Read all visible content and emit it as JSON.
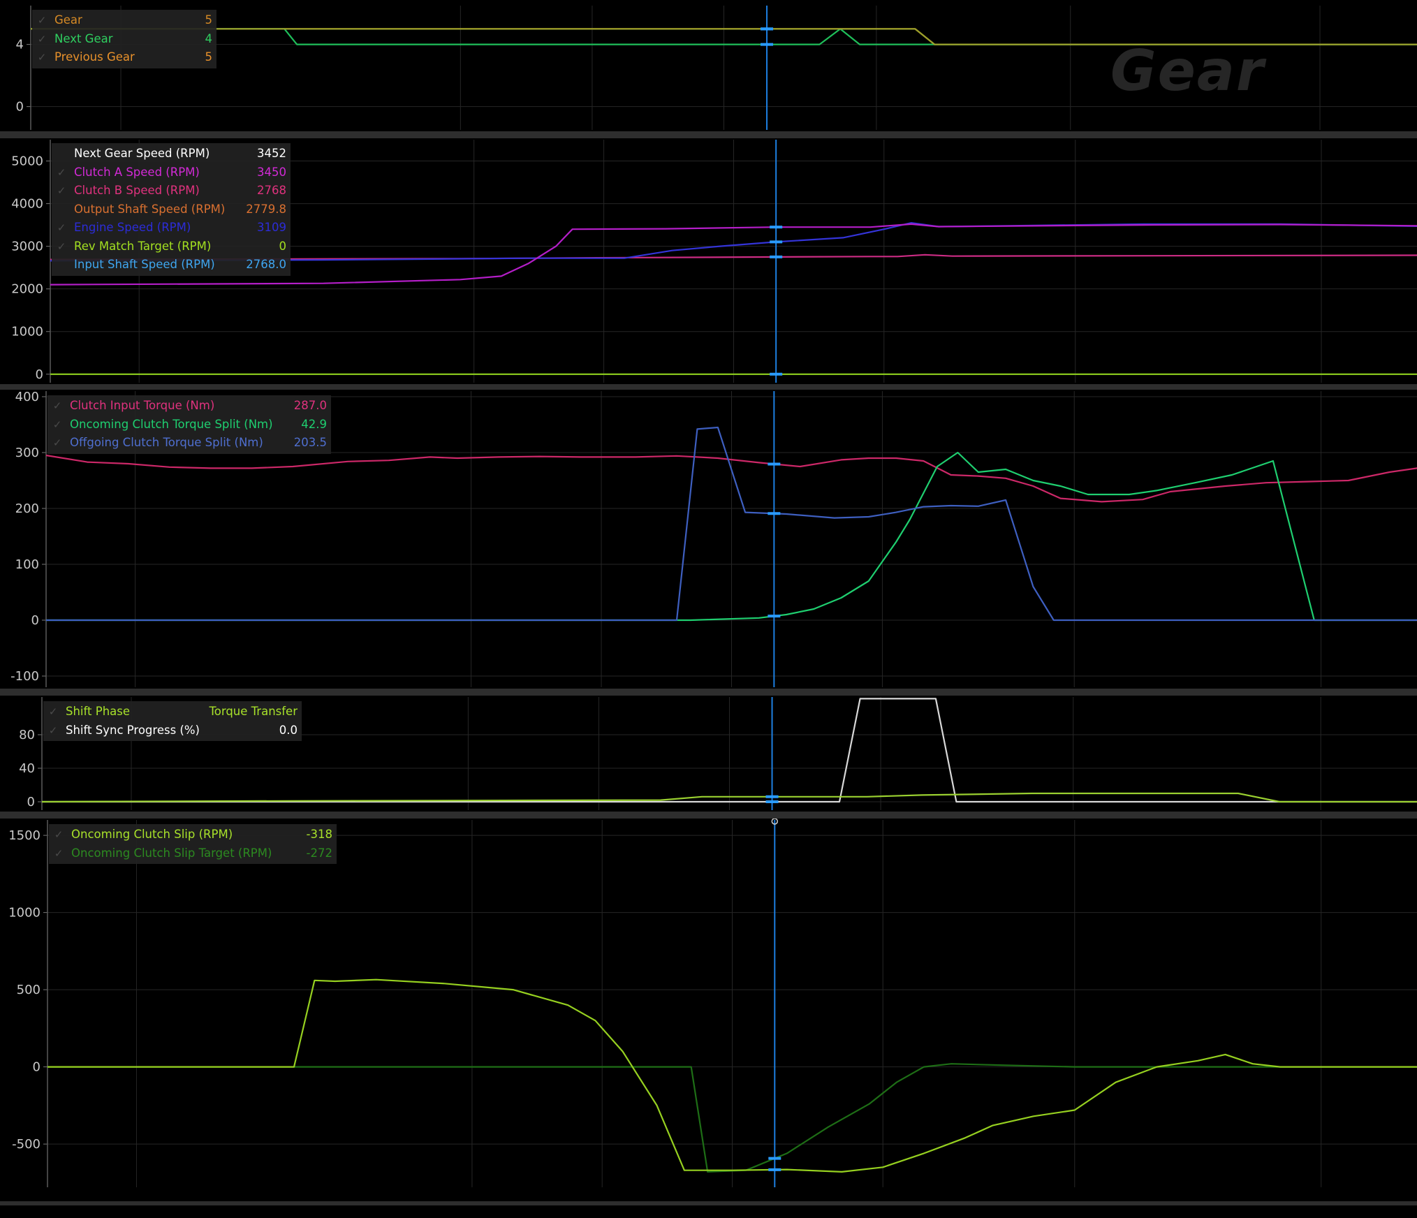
{
  "watermark": "Gear",
  "colors": {
    "background": "#000000",
    "gridline": "#262626",
    "cursor": "#1d7fe0",
    "separator": "#2e2e2e"
  },
  "cursor_marker_icon": "ring-marker-icon",
  "chart_data": [
    {
      "type": "line",
      "title": "Gear",
      "yticks": [
        4,
        0
      ],
      "ylim": [
        -1.5,
        6.5
      ],
      "xlim": [
        0,
        1000
      ],
      "cursor_x": 531,
      "legend": [
        {
          "name": "Gear",
          "value": "5",
          "color": "#d68a25",
          "checked": true
        },
        {
          "name": "Next Gear",
          "value": "4",
          "color": "#2fcf60",
          "checked": true
        },
        {
          "name": "Previous Gear",
          "value": "5",
          "color": "#e8912b",
          "checked": true
        }
      ],
      "series": [
        {
          "name": "Gear",
          "color": "#d68a25",
          "points": [
            [
              0,
              5
            ],
            [
              638,
              5
            ],
            [
              652,
              4
            ],
            [
              1000,
              4
            ]
          ]
        },
        {
          "name": "Next Gear",
          "color": "#1fbf5a",
          "points": [
            [
              0,
              5
            ],
            [
              183,
              5
            ],
            [
              192,
              4
            ],
            [
              569,
              4
            ],
            [
              584,
              5
            ],
            [
              598,
              4
            ],
            [
              1000,
              4
            ]
          ]
        },
        {
          "name": "Previous Gear",
          "color": "#9aa02b",
          "points": [
            [
              0,
              5
            ],
            [
              638,
              5
            ],
            [
              652,
              4
            ],
            [
              1000,
              4
            ]
          ]
        }
      ]
    },
    {
      "type": "line",
      "title": "",
      "yticks": [
        5000,
        4000,
        3000,
        2000,
        1000,
        0
      ],
      "ylim": [
        -200,
        5500
      ],
      "xlim": [
        0,
        1000
      ],
      "cursor_x": 531,
      "legend": [
        {
          "name": "Next Gear Speed (RPM)",
          "value": "3452",
          "color": "#ffffff",
          "checked": false
        },
        {
          "name": "Clutch A Speed (RPM)",
          "value": "3450",
          "color": "#d22ad6",
          "checked": true
        },
        {
          "name": "Clutch B Speed (RPM)",
          "value": "2768",
          "color": "#e0327e",
          "checked": true
        },
        {
          "name": "Output Shaft Speed (RPM)",
          "value": "2779.8",
          "color": "#d97030",
          "checked": false
        },
        {
          "name": "Engine Speed (RPM)",
          "value": "3109",
          "color": "#2c2cd8",
          "checked": true
        },
        {
          "name": "Rev Match Target (RPM)",
          "value": "0",
          "color": "#a3e020",
          "checked": true
        },
        {
          "name": "Input Shaft Speed (RPM)",
          "value": "2768.0",
          "color": "#3fa6f0",
          "checked": false
        }
      ],
      "series": [
        {
          "name": "Rev Match Target (RPM)",
          "color": "#8fd01e",
          "points": [
            [
              0,
              0
            ],
            [
              1000,
              0
            ]
          ]
        },
        {
          "name": "Clutch B Speed (RPM)",
          "color": "#cc2c84",
          "points": [
            [
              0,
              2690
            ],
            [
              300,
              2710
            ],
            [
              400,
              2730
            ],
            [
              600,
              2760
            ],
            [
              620,
              2760
            ],
            [
              640,
              2800
            ],
            [
              660,
              2770
            ],
            [
              1000,
              2790
            ]
          ]
        },
        {
          "name": "Engine Speed (RPM)",
          "color": "#3434d8",
          "points": [
            [
              0,
              2660
            ],
            [
              200,
              2680
            ],
            [
              350,
              2720
            ],
            [
              420,
              2720
            ],
            [
              455,
              2900
            ],
            [
              490,
              3000
            ],
            [
              530,
              3100
            ],
            [
              580,
              3200
            ],
            [
              610,
              3400
            ],
            [
              630,
              3550
            ],
            [
              650,
              3460
            ],
            [
              700,
              3480
            ],
            [
              800,
              3520
            ],
            [
              900,
              3520
            ],
            [
              1000,
              3470
            ]
          ]
        },
        {
          "name": "Clutch A Speed (RPM)",
          "color": "#b41ec8",
          "points": [
            [
              0,
              2100
            ],
            [
              200,
              2130
            ],
            [
              300,
              2220
            ],
            [
              330,
              2300
            ],
            [
              350,
              2600
            ],
            [
              370,
              3000
            ],
            [
              382,
              3400
            ],
            [
              450,
              3410
            ],
            [
              530,
              3450
            ],
            [
              600,
              3450
            ],
            [
              630,
              3520
            ],
            [
              650,
              3460
            ],
            [
              800,
              3500
            ],
            [
              900,
              3510
            ],
            [
              1000,
              3480
            ]
          ]
        }
      ]
    },
    {
      "type": "line",
      "title": "",
      "yticks": [
        400,
        300,
        200,
        100,
        0,
        -100
      ],
      "ylim": [
        -120,
        410
      ],
      "xlim": [
        0,
        1000
      ],
      "cursor_x": 531,
      "legend": [
        {
          "name": "Clutch Input Torque (Nm)",
          "value": "287.0",
          "color": "#e0327e",
          "checked": true
        },
        {
          "name": "Oncoming Clutch Torque Split (Nm)",
          "value": "42.9",
          "color": "#1fcf70",
          "checked": true
        },
        {
          "name": "Offgoing Clutch Torque Split (Nm)",
          "value": "203.5",
          "color": "#4f6fd0",
          "checked": true
        }
      ],
      "series": [
        {
          "name": "Clutch Input Torque (Nm)",
          "color": "#cc2868",
          "points": [
            [
              0,
              295
            ],
            [
              30,
              283
            ],
            [
              60,
              280
            ],
            [
              90,
              274
            ],
            [
              120,
              272
            ],
            [
              150,
              272
            ],
            [
              180,
              275
            ],
            [
              220,
              284
            ],
            [
              250,
              286
            ],
            [
              280,
              292
            ],
            [
              300,
              290
            ],
            [
              330,
              292
            ],
            [
              360,
              293
            ],
            [
              390,
              292
            ],
            [
              430,
              292
            ],
            [
              460,
              294
            ],
            [
              490,
              290
            ],
            [
              520,
              282
            ],
            [
              550,
              275
            ],
            [
              580,
              287
            ],
            [
              600,
              290
            ],
            [
              620,
              290
            ],
            [
              640,
              285
            ],
            [
              660,
              260
            ],
            [
              680,
              258
            ],
            [
              700,
              254
            ],
            [
              720,
              240
            ],
            [
              740,
              218
            ],
            [
              770,
              212
            ],
            [
              800,
              216
            ],
            [
              820,
              230
            ],
            [
              860,
              240
            ],
            [
              890,
              246
            ],
            [
              920,
              248
            ],
            [
              950,
              250
            ],
            [
              980,
              265
            ],
            [
              1000,
              272
            ],
            [
              1018,
              273
            ],
            [
              1035,
              250
            ],
            [
              1050,
              200
            ],
            [
              1065,
              110
            ],
            [
              1085,
              40
            ],
            [
              1105,
              10
            ],
            [
              1125,
              -20
            ],
            [
              1150,
              -35
            ],
            [
              1180,
              -45
            ],
            [
              1200,
              -50
            ]
          ]
        },
        {
          "name": "Oncoming Clutch Torque Split (Nm)",
          "color": "#1fcf70",
          "points": [
            [
              0,
              0
            ],
            [
              470,
              0
            ],
            [
              520,
              4
            ],
            [
              540,
              10
            ],
            [
              560,
              20
            ],
            [
              580,
              40
            ],
            [
              600,
              70
            ],
            [
              620,
              140
            ],
            [
              630,
              180
            ],
            [
              650,
              275
            ],
            [
              665,
              300
            ],
            [
              680,
              265
            ],
            [
              700,
              270
            ],
            [
              720,
              250
            ],
            [
              740,
              240
            ],
            [
              760,
              225
            ],
            [
              790,
              225
            ],
            [
              810,
              232
            ],
            [
              840,
              247
            ],
            [
              865,
              260
            ],
            [
              895,
              285
            ],
            [
              925,
              0
            ],
            [
              1000,
              0
            ]
          ]
        },
        {
          "name": "Offgoing Clutch Torque Split (Nm)",
          "color": "#3e5fc0",
          "points": [
            [
              0,
              0
            ],
            [
              460,
              0
            ],
            [
              475,
              342
            ],
            [
              490,
              345
            ],
            [
              510,
              193
            ],
            [
              540,
              190
            ],
            [
              575,
              183
            ],
            [
              600,
              185
            ],
            [
              620,
              193
            ],
            [
              640,
              203
            ],
            [
              660,
              205
            ],
            [
              680,
              204
            ],
            [
              700,
              215
            ],
            [
              720,
              60
            ],
            [
              735,
              0
            ],
            [
              1000,
              0
            ]
          ]
        }
      ]
    },
    {
      "type": "line",
      "title": "",
      "yticks": [
        80,
        40,
        0
      ],
      "ylim": [
        -10,
        125
      ],
      "xlim": [
        0,
        1000
      ],
      "cursor_x": 531,
      "legend": [
        {
          "name": "Shift Phase",
          "value": "Torque Transfer",
          "color": "#a8e22a",
          "checked": true
        },
        {
          "name": "Shift Sync Progress (%)",
          "value": "0.0",
          "color": "#ffffff",
          "checked": true
        }
      ],
      "series": [
        {
          "name": "Shift Sync Progress (%)",
          "color": "#d8d8d8",
          "points": [
            [
              0,
              0
            ],
            [
              580,
              0
            ],
            [
              595,
              123
            ],
            [
              650,
              123
            ],
            [
              665,
              0
            ],
            [
              1000,
              0
            ]
          ]
        },
        {
          "name": "Shift Phase",
          "color": "#9ad030",
          "points": [
            [
              0,
              0
            ],
            [
              180,
              1
            ],
            [
              450,
              2
            ],
            [
              480,
              6
            ],
            [
              600,
              6
            ],
            [
              640,
              8
            ],
            [
              720,
              10
            ],
            [
              870,
              10
            ],
            [
              900,
              0
            ],
            [
              1000,
              0
            ]
          ]
        }
      ]
    },
    {
      "type": "line",
      "title": "",
      "yticks": [
        1500,
        1000,
        500,
        0,
        -500
      ],
      "ylim": [
        -780,
        1600
      ],
      "xlim": [
        0,
        1000
      ],
      "cursor_x": 531,
      "legend": [
        {
          "name": "Oncoming Clutch Slip (RPM)",
          "value": "-318",
          "color": "#a8e22a",
          "checked": true
        },
        {
          "name": "Oncoming Clutch Slip Target (RPM)",
          "value": "-272",
          "color": "#2c8a20",
          "checked": true
        }
      ],
      "series": [
        {
          "name": "Oncoming Clutch Slip Target (RPM)",
          "color": "#1e6e16",
          "points": [
            [
              0,
              0
            ],
            [
              470,
              0
            ],
            [
              482,
              -680
            ],
            [
              510,
              -670
            ],
            [
              540,
              -560
            ],
            [
              570,
              -390
            ],
            [
              600,
              -240
            ],
            [
              620,
              -100
            ],
            [
              640,
              0
            ],
            [
              660,
              20
            ],
            [
              700,
              10
            ],
            [
              750,
              0
            ],
            [
              1000,
              0
            ]
          ]
        },
        {
          "name": "Oncoming Clutch Slip (RPM)",
          "color": "#96d020",
          "points": [
            [
              0,
              0
            ],
            [
              180,
              0
            ],
            [
              195,
              560
            ],
            [
              210,
              555
            ],
            [
              240,
              565
            ],
            [
              290,
              540
            ],
            [
              340,
              500
            ],
            [
              380,
              400
            ],
            [
              400,
              300
            ],
            [
              420,
              100
            ],
            [
              445,
              -250
            ],
            [
              465,
              -670
            ],
            [
              500,
              -670
            ],
            [
              540,
              -665
            ],
            [
              580,
              -680
            ],
            [
              610,
              -650
            ],
            [
              640,
              -560
            ],
            [
              670,
              -460
            ],
            [
              690,
              -380
            ],
            [
              720,
              -320
            ],
            [
              750,
              -280
            ],
            [
              780,
              -100
            ],
            [
              810,
              0
            ],
            [
              840,
              40
            ],
            [
              860,
              80
            ],
            [
              880,
              20
            ],
            [
              900,
              0
            ],
            [
              1000,
              0
            ]
          ]
        }
      ]
    }
  ]
}
